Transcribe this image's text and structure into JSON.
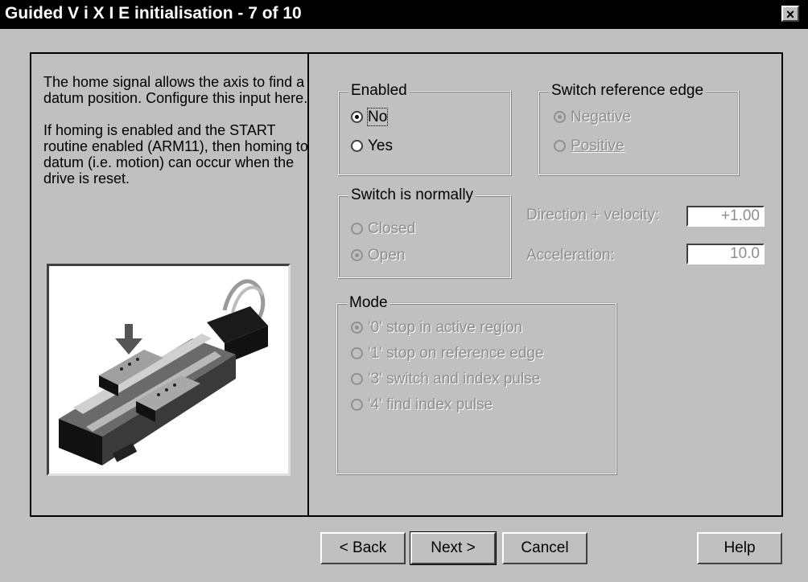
{
  "window": {
    "title": "Guided V i X I E initialisation - 7 of 10",
    "close_label": "×"
  },
  "description": {
    "paragraph1": "The home signal allows the axis to find a datum position. Configure this input here.",
    "paragraph2": "If homing is enabled and the START routine enabled (ARM11), then homing to datum (i.e. motion) can occur when the drive is reset."
  },
  "enabled_group": {
    "legend": "Enabled",
    "options": [
      "No",
      "Yes"
    ],
    "selected": "No"
  },
  "switch_ref_group": {
    "legend": "Switch reference edge",
    "options": [
      "Negative",
      "Positive"
    ],
    "selected": "Negative"
  },
  "switch_normally_group": {
    "legend": "Switch is normally",
    "options": [
      "Closed",
      "Open"
    ],
    "selected": "Open"
  },
  "direction_velocity": {
    "label": "Direction + velocity:",
    "value": "+1.00"
  },
  "acceleration": {
    "label": "Acceleration:",
    "value": "10.0"
  },
  "mode_group": {
    "legend": "Mode",
    "options": [
      "'0' stop in active region",
      "'1' stop on reference edge",
      "'3' switch and index pulse",
      "'4' find index pulse"
    ],
    "selected": "'0' stop in active region"
  },
  "buttons": {
    "back": "< Back",
    "next": "Next >",
    "cancel": "Cancel",
    "help": "Help"
  },
  "colors": {
    "title_bg": "#000000",
    "face": "#c0c0c0",
    "disabled_text": "#8e8e8e"
  },
  "icons": [
    "close-icon",
    "down-arrow-icon",
    "linear-actuator-image"
  ]
}
